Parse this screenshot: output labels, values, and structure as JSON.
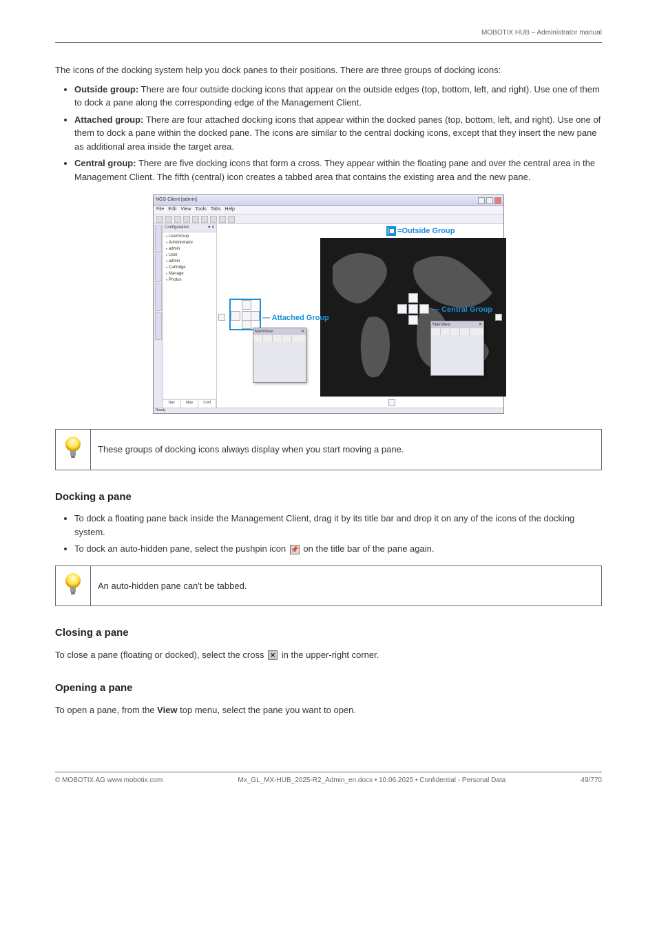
{
  "header": {
    "product": "MOBOTIX HUB – Administrator manual"
  },
  "intro": "The icons of the docking system help you dock panes to their positions. There are three groups of docking icons:",
  "icon_groups": [
    "Outside group: There are four outside docking icons that appear on the outside edges (top, bottom, left, and right). Use one of them to dock a pane along the corresponding edge of the Management Client.",
    "Attached group: There are four attached docking icons that appear within the docked panes (top, bottom, left, and right). Use one of them to dock a pane within the docked pane. The icons are similar to the central docking icons, except that they insert the new pane as additional area inside the target area.",
    "Central group: There are five docking icons that form a cross. They appear within the floating pane and over the central area in the Management Client. The fifth (central) icon creates a tabbed area that contains the existing area and the new pane."
  ],
  "icon_groups_bold": [
    "Outside group:",
    "Attached group:",
    "Central group:"
  ],
  "tip1": "These groups of docking icons always display when you start moving a pane.",
  "tip2": "An auto-hidden pane can't be tabbed.",
  "section_dock": {
    "title": "Docking a pane",
    "steps": [
      {
        "pre": "To dock a floating pane back inside the Management Client, drag it by its title bar and drop it on any of the icons of the docking system.",
        "bold_ranges": []
      },
      {
        "pre": "To dock an auto-hidden pane, select the pushpin icon ",
        "post": " on the title bar of the pane again.",
        "icon": "pin"
      }
    ]
  },
  "section_close": {
    "title": "Closing a pane",
    "text_pre": "To close a pane (floating or docked), select the cross ",
    "text_post": " in the upper-right corner.",
    "icon": "x"
  },
  "section_open": {
    "title": "Opening a pane",
    "text_pre": "To open a pane, from the ",
    "bold": "View",
    "text_post": " top menu, select the pane you want to open."
  },
  "footer": {
    "copyright": "© MOBOTIX AG www.mobotix.com",
    "confidential": "Mx_GL_MX-HUB_2025-R2_Admin_en.docx • 10.06.2025 • Confidential - Personal Data",
    "page": "49/770"
  },
  "screenshot": {
    "title": "NGS Client [admin]",
    "menu": [
      "File",
      "Edit",
      "View",
      "Tools",
      "Tabs",
      "Help"
    ],
    "tree_header": "Configuration",
    "tree_items": [
      "UserGroup",
      " Administrator",
      "  admin",
      " User",
      "  admin",
      " Cartridge",
      "  Manage",
      " Photos"
    ],
    "tree_tabs": [
      "Nav",
      "Map",
      "Conf"
    ],
    "floating1": {
      "title": "MainView"
    },
    "floating2": {
      "title": "MainView"
    },
    "status": "Ready",
    "labels": {
      "outside": "Outside Group",
      "attached": "Attached Group",
      "central": "Central Group"
    }
  }
}
